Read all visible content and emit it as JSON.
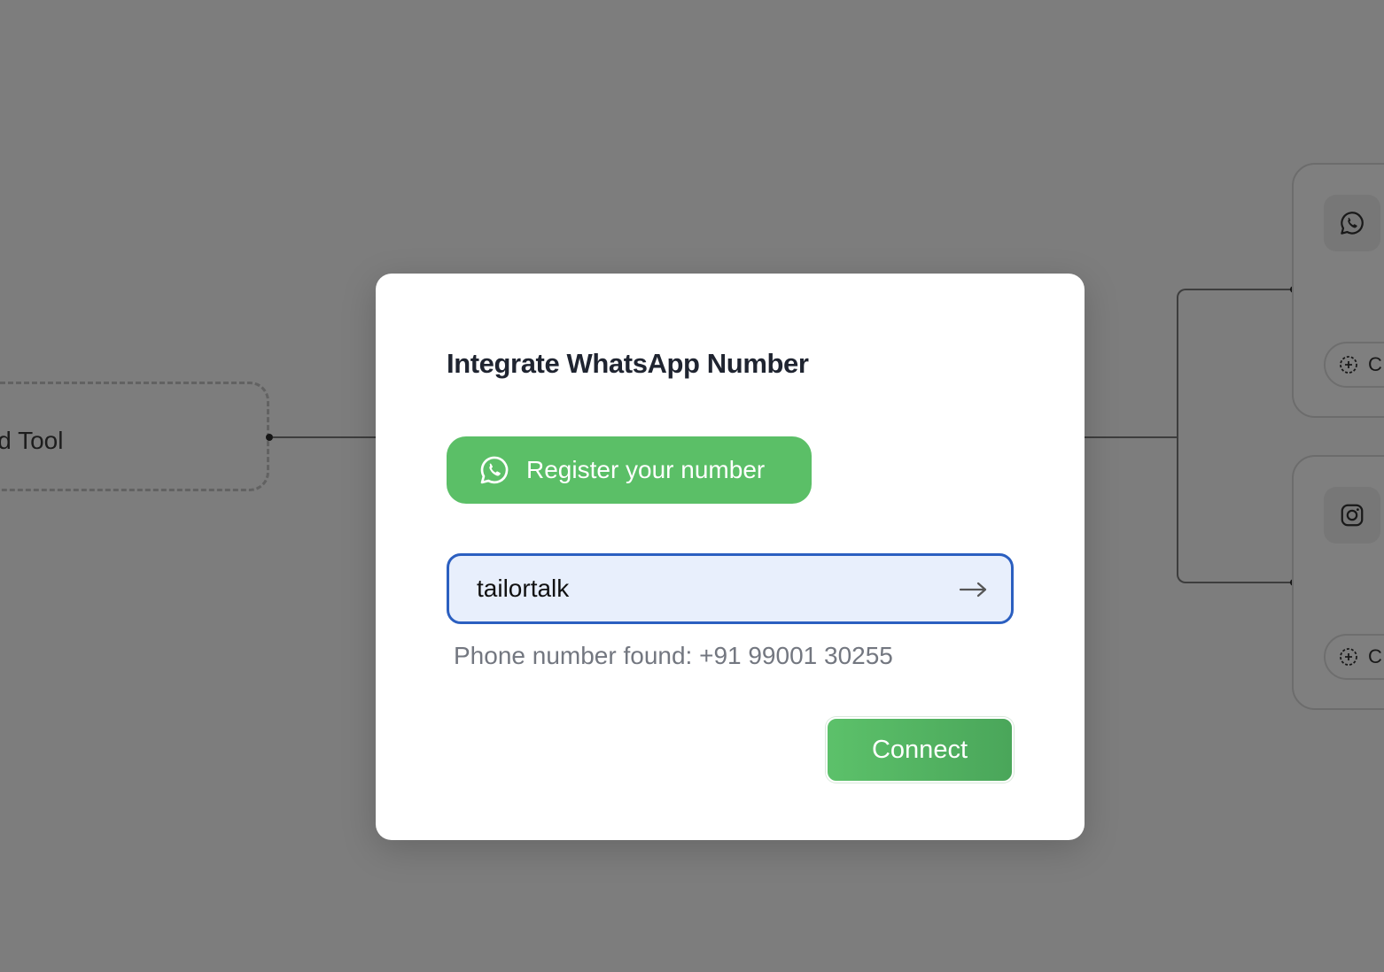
{
  "canvas": {
    "tool_node_label": "Add Tool",
    "channel_cards": [
      {
        "icon": "whatsapp-icon",
        "add_label": "C"
      },
      {
        "icon": "instagram-icon",
        "add_label": "C"
      }
    ]
  },
  "modal": {
    "title": "Integrate WhatsApp Number",
    "register_button_label": "Register your number",
    "input": {
      "value": "tailortalk",
      "placeholder": ""
    },
    "submit_icon": "arrow-right-icon",
    "status_text": "Phone number found: +91 99001 30255",
    "connect_button_label": "Connect"
  },
  "colors": {
    "primary_green": "#5bbf67",
    "input_border": "#2b5fc0",
    "input_bg": "#e8effc",
    "overlay": "rgba(0,0,0,0.5)"
  }
}
